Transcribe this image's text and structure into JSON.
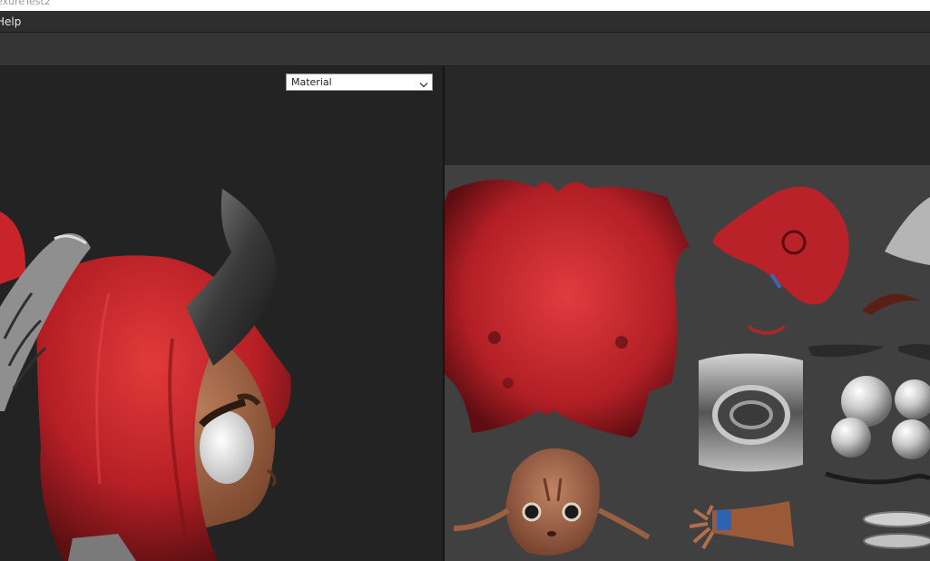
{
  "window": {
    "title": "exureTest2"
  },
  "menu": {
    "items": [
      {
        "label": "Help"
      }
    ]
  },
  "viewport": {
    "mode_select": {
      "value": "Material"
    }
  },
  "colors": {
    "hair_red": "#c8242a",
    "skin": "#a8694a",
    "horn": "#3a3a3a",
    "uv_background": "#404040"
  },
  "icons": {
    "dropdown": "chevron-down-icon"
  }
}
